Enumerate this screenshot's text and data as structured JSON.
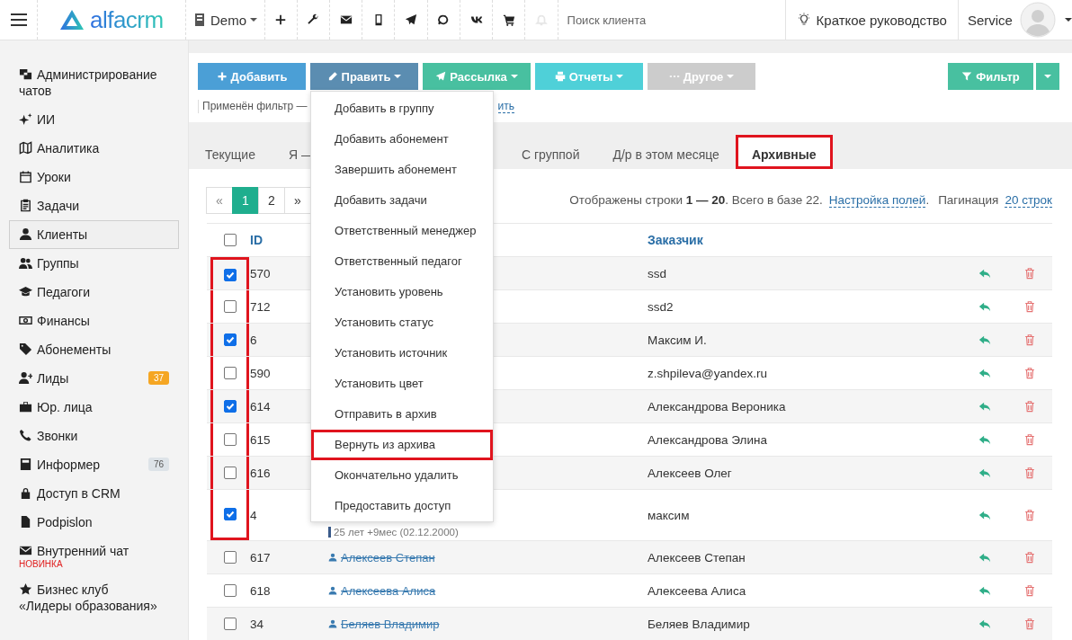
{
  "topbar": {
    "logo": "alfacrm",
    "branch": "Demo",
    "search": {
      "placeholder": "Поиск клиента"
    },
    "guide": "Краткое руководство",
    "user": "Service"
  },
  "sidebar": {
    "items": [
      {
        "label": "Администрирование чатов",
        "selected": false
      },
      {
        "label": "ИИ",
        "selected": false
      },
      {
        "label": "Аналитика",
        "selected": false
      },
      {
        "label": "Уроки",
        "selected": false
      },
      {
        "label": "Задачи",
        "selected": false
      },
      {
        "label": "Клиенты",
        "selected": true
      },
      {
        "label": "Группы",
        "selected": false
      },
      {
        "label": "Педагоги",
        "selected": false
      },
      {
        "label": "Финансы",
        "selected": false
      },
      {
        "label": "Абонементы",
        "selected": false
      },
      {
        "label": "Лиды",
        "selected": false,
        "badge": "37",
        "color": "#f5a623"
      },
      {
        "label": "Юр. лица",
        "selected": false
      },
      {
        "label": "Звонки",
        "selected": false
      },
      {
        "label": "Информер",
        "selected": false,
        "badge": "76",
        "color": "#dde3e8"
      },
      {
        "label": "Доступ в CRM",
        "selected": false
      },
      {
        "label": "Podpislon",
        "selected": false
      },
      {
        "label": "Внутренний чат",
        "selected": false,
        "note": "НОВИНКА"
      },
      {
        "label": "Бизнес клуб",
        "label_2": "«Лидеры образования»",
        "selected": false
      }
    ]
  },
  "toolbar": {
    "buttons": [
      {
        "label": "Добавить",
        "color": "#4b9fd6"
      },
      {
        "label": "Править",
        "color": "#5b8db1",
        "menu": {
          "items": [
            {
              "label": "Добавить в группу",
              "highlighted": false
            },
            {
              "label": "Добавить абонемент",
              "highlighted": false
            },
            {
              "label": "Завершить абонемент",
              "highlighted": false
            },
            {
              "label": "Добавить задачи",
              "highlighted": false
            },
            {
              "label": "Ответственный менеджер",
              "highlighted": false
            },
            {
              "label": "Ответственный педагог",
              "highlighted": false
            },
            {
              "label": "Установить уровень",
              "highlighted": false
            },
            {
              "label": "Установить статус",
              "highlighted": false
            },
            {
              "label": "Установить источник",
              "highlighted": false
            },
            {
              "label": "Установить цвет",
              "highlighted": false
            },
            {
              "label": "Отправить в архив",
              "highlighted": false
            },
            {
              "label": "Вернуть из архива",
              "highlighted": true
            },
            {
              "label": "Окончательно удалить",
              "highlighted": false
            },
            {
              "label": "Предоставить доступ",
              "highlighted": false
            }
          ]
        }
      },
      {
        "label": "Рассылка",
        "color": "#48c0a0"
      },
      {
        "label": "Отчеты",
        "color": "#4fd0d8"
      },
      {
        "label": "Другое",
        "color": "#cccccc"
      }
    ],
    "filter_button": {
      "label": "Фильтр"
    },
    "filter_note": {
      "text": "Применён фильтр —",
      "link": "ить"
    }
  },
  "tabs": [
    {
      "label": "Текущие",
      "kind": "plain",
      "selected": false,
      "highlighted": false
    },
    {
      "label": "Я —",
      "kind": "covered",
      "selected": false,
      "highlighted": false
    },
    {
      "label": "С группой",
      "kind": "plain",
      "selected": false,
      "highlighted": false
    },
    {
      "label": "Д/р в этом месяце",
      "kind": "plain",
      "selected": false,
      "highlighted": false
    },
    {
      "label": "Архивные",
      "kind": "plain",
      "selected": true,
      "highlighted": true
    }
  ],
  "pagination": [
    {
      "label": "«",
      "selected": false
    },
    {
      "label": "1",
      "selected": true
    },
    {
      "label": "2",
      "selected": false
    },
    {
      "label": "»",
      "selected": false
    }
  ],
  "summary": {
    "text": "Отображены строки **1 — 20**. Всего в базе 22.",
    "fields_link": "Настройка полей",
    "after_link": ".",
    "paging_label": "Пагинация",
    "paging_link": "20 строк"
  },
  "table": {
    "columns": [
      "ID",
      "Заказчик"
    ],
    "header_checked": false,
    "rows": [
      {
        "checked": true,
        "framed": true,
        "id": "570",
        "customer": "ssd"
      },
      {
        "checked": false,
        "framed": true,
        "id": "712",
        "customer": "ssd2"
      },
      {
        "checked": true,
        "framed": true,
        "id": "6",
        "customer": "Максим И."
      },
      {
        "checked": false,
        "framed": true,
        "id": "590",
        "customer": "z.shpileva@yandex.ru"
      },
      {
        "checked": true,
        "framed": true,
        "id": "614",
        "customer": "Александрова Вероника"
      },
      {
        "checked": false,
        "framed": true,
        "id": "615",
        "customer": "Александрова Элина"
      },
      {
        "checked": false,
        "framed": true,
        "id": "616",
        "customer": "Алексеев Олег"
      },
      {
        "checked": true,
        "framed": true,
        "id": "4",
        "age": "25 лет +9мес (02.12.2000)",
        "customer": "максим"
      },
      {
        "checked": false,
        "framed": false,
        "id": "617",
        "name": "Алексеев Степан",
        "customer": "Алексеев Степан"
      },
      {
        "checked": false,
        "framed": false,
        "id": "618",
        "name": "Алексеева Алиса",
        "customer": "Алексеева Алиса"
      },
      {
        "checked": false,
        "framed": false,
        "id": "34",
        "name": "Беляев Владимир",
        "customer": "Беляев Владимир"
      }
    ]
  }
}
